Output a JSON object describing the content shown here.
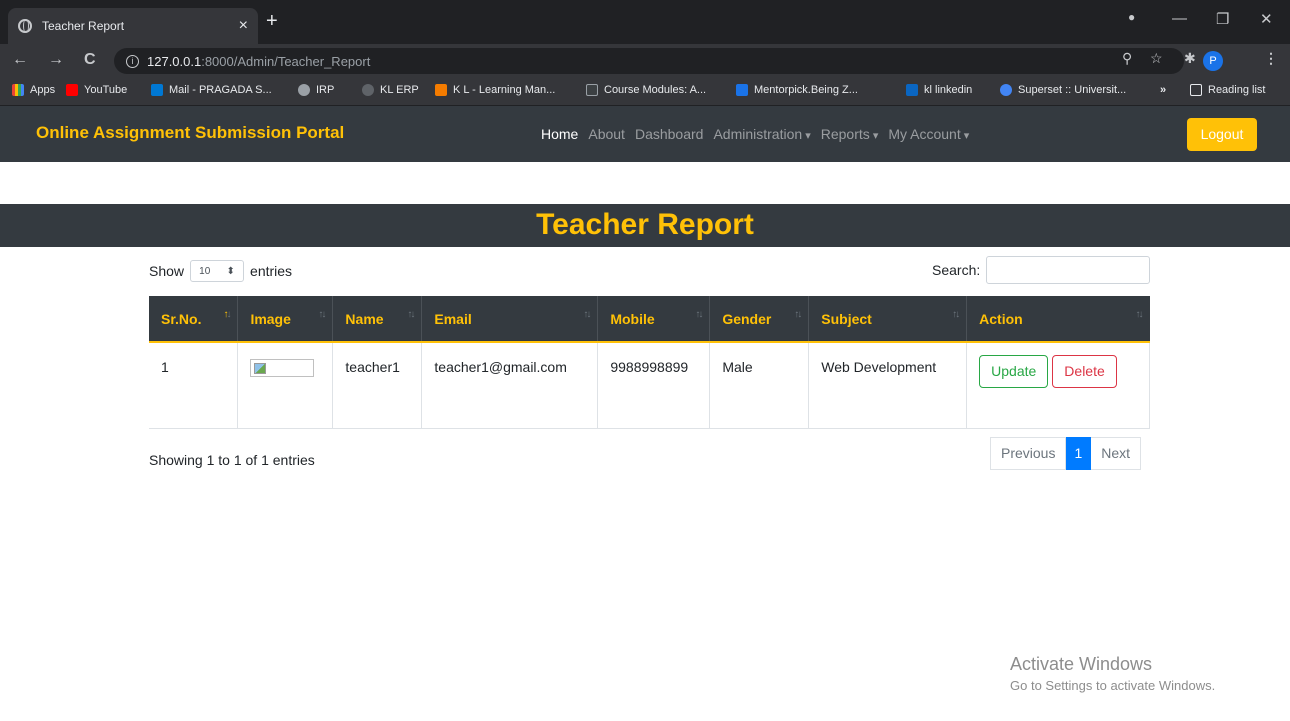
{
  "browser": {
    "tab_title": "Teacher Report",
    "tab_close": "×",
    "new_tab": "+",
    "url_host": "127.0.0.1",
    "url_path": ":8000/Admin/Teacher_Report",
    "profile_initial": "P",
    "bookmarks": [
      {
        "label": "Apps",
        "color": "#ea4335"
      },
      {
        "label": "YouTube",
        "color": "#ff0000"
      },
      {
        "label": "Mail - PRAGADA S...",
        "color": "#0078d4"
      },
      {
        "label": "IRP",
        "color": "#9aa0a6"
      },
      {
        "label": "KL ERP",
        "color": "#5f6368"
      },
      {
        "label": "K L - Learning Man...",
        "color": "#f57c00"
      },
      {
        "label": "Course Modules: A...",
        "color": "#3c4043"
      },
      {
        "label": "Mentorpick.Being Z...",
        "color": "#1a73e8"
      },
      {
        "label": "kl linkedin",
        "color": "#0a66c2"
      },
      {
        "label": "Superset :: Universit...",
        "color": "#4285f4"
      }
    ],
    "bookmarks_more": "»",
    "reading_list": "Reading list"
  },
  "navbar": {
    "brand": "Online Assignment Submission Portal",
    "links": [
      "Home",
      "About",
      "Dashboard",
      "Administration",
      "Reports",
      "My Account"
    ],
    "logout": "Logout",
    "accent": "#ffc107"
  },
  "page": {
    "title": "Teacher Report"
  },
  "datatable": {
    "show_label": "Show",
    "length_value": "10",
    "entries_label": "entries",
    "search_label": "Search:",
    "columns": [
      "Sr.No.",
      "Image",
      "Name",
      "Email",
      "Mobile",
      "Gender",
      "Subject",
      "Action"
    ],
    "rows": [
      {
        "sr": "1",
        "name": "teacher1",
        "email": "teacher1@gmail.com",
        "mobile": "9988998899",
        "gender": "Male",
        "subject": "Web Development",
        "update": "Update",
        "delete": "Delete"
      }
    ],
    "info": "Showing 1 to 1 of 1 entries",
    "previous": "Previous",
    "current_page": "1",
    "next": "Next"
  },
  "watermark": {
    "line1": "Activate Windows",
    "line2": "Go to Settings to activate Windows."
  }
}
